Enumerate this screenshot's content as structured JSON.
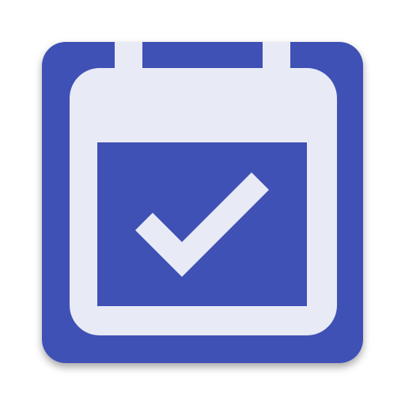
{
  "app_icon": {
    "name": "calendar-check",
    "icon": "calendar-check-icon",
    "colors": {
      "tile": "#3f51b5",
      "calendar_body": "#e8eaf6",
      "calendar_face": "#3f51b5",
      "checkmark": "#e8eaf6",
      "shadow": "#000000"
    }
  }
}
